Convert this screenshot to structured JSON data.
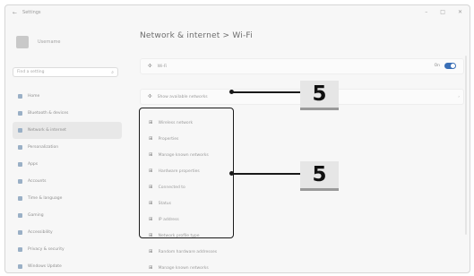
{
  "window": {
    "title": "Settings",
    "back_glyph": "←",
    "controls": [
      "–",
      "□",
      "✕"
    ]
  },
  "sidebar": {
    "user_name": "Username",
    "search_placeholder": "Find a setting",
    "search_glyph": "⌕",
    "items": [
      {
        "label": "Home"
      },
      {
        "label": "Bluetooth & devices"
      },
      {
        "label": "Network & internet",
        "active": true
      },
      {
        "label": "Personalization"
      },
      {
        "label": "Apps"
      },
      {
        "label": "Accounts"
      },
      {
        "label": "Time & language"
      },
      {
        "label": "Gaming"
      },
      {
        "label": "Accessibility"
      },
      {
        "label": "Privacy & security"
      },
      {
        "label": "Windows Update"
      }
    ]
  },
  "main": {
    "title": "Network & internet  >  Wi-Fi",
    "wifi_row": {
      "label": "Wi-Fi",
      "toggle_label": "On"
    },
    "available_row": {
      "label": "Show available networks"
    },
    "properties": [
      "Wireless network",
      "Properties",
      "Manage known networks",
      "Hardware properties",
      "Connected to",
      "Status",
      "IP address",
      "Network profile type"
    ],
    "extra_rows": [
      "Random hardware addresses",
      "Manage known networks"
    ]
  },
  "callouts": {
    "top_number": "5",
    "middle_number": "5"
  },
  "icons": {
    "wifi": "wifi-icon",
    "network": "network-icon",
    "chevron": "chevron-right-icon"
  }
}
